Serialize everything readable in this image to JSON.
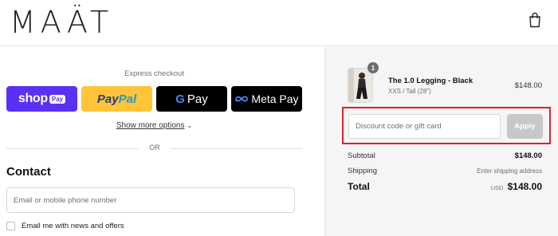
{
  "header": {
    "logo": "MAÄT",
    "cart_icon": "shopping-bag-icon"
  },
  "express": {
    "label": "Express checkout",
    "buttons": [
      {
        "brand": "shop",
        "text": "shop",
        "pill": "Pay",
        "bg": "#5a31f4"
      },
      {
        "brand": "paypal",
        "text_a": "Pay",
        "text_b": "Pal",
        "bg": "#ffc439"
      },
      {
        "brand": "gpay",
        "g": "G",
        "text": "Pay",
        "bg": "#000000"
      },
      {
        "brand": "metapay",
        "text": "Meta Pay",
        "bg": "#000000"
      }
    ],
    "show_more": "Show more options",
    "or": "OR"
  },
  "contact": {
    "title": "Contact",
    "input_placeholder": "Email or mobile phone number",
    "newsletter_label": "Email me with news and offers"
  },
  "order": {
    "item": {
      "quantity": "1",
      "name": "The 1.0 Legging - Black",
      "variant": "XXS / Tall (28\")",
      "price": "$148.00"
    },
    "discount": {
      "placeholder": "Discount code or gift card",
      "apply": "Apply",
      "highlight_color": "#e0202a"
    },
    "subtotal_label": "Subtotal",
    "subtotal": "$148.00",
    "shipping_label": "Shipping",
    "shipping": "Enter shipping address",
    "total_label": "Total",
    "currency": "USD",
    "total": "$148.00"
  }
}
